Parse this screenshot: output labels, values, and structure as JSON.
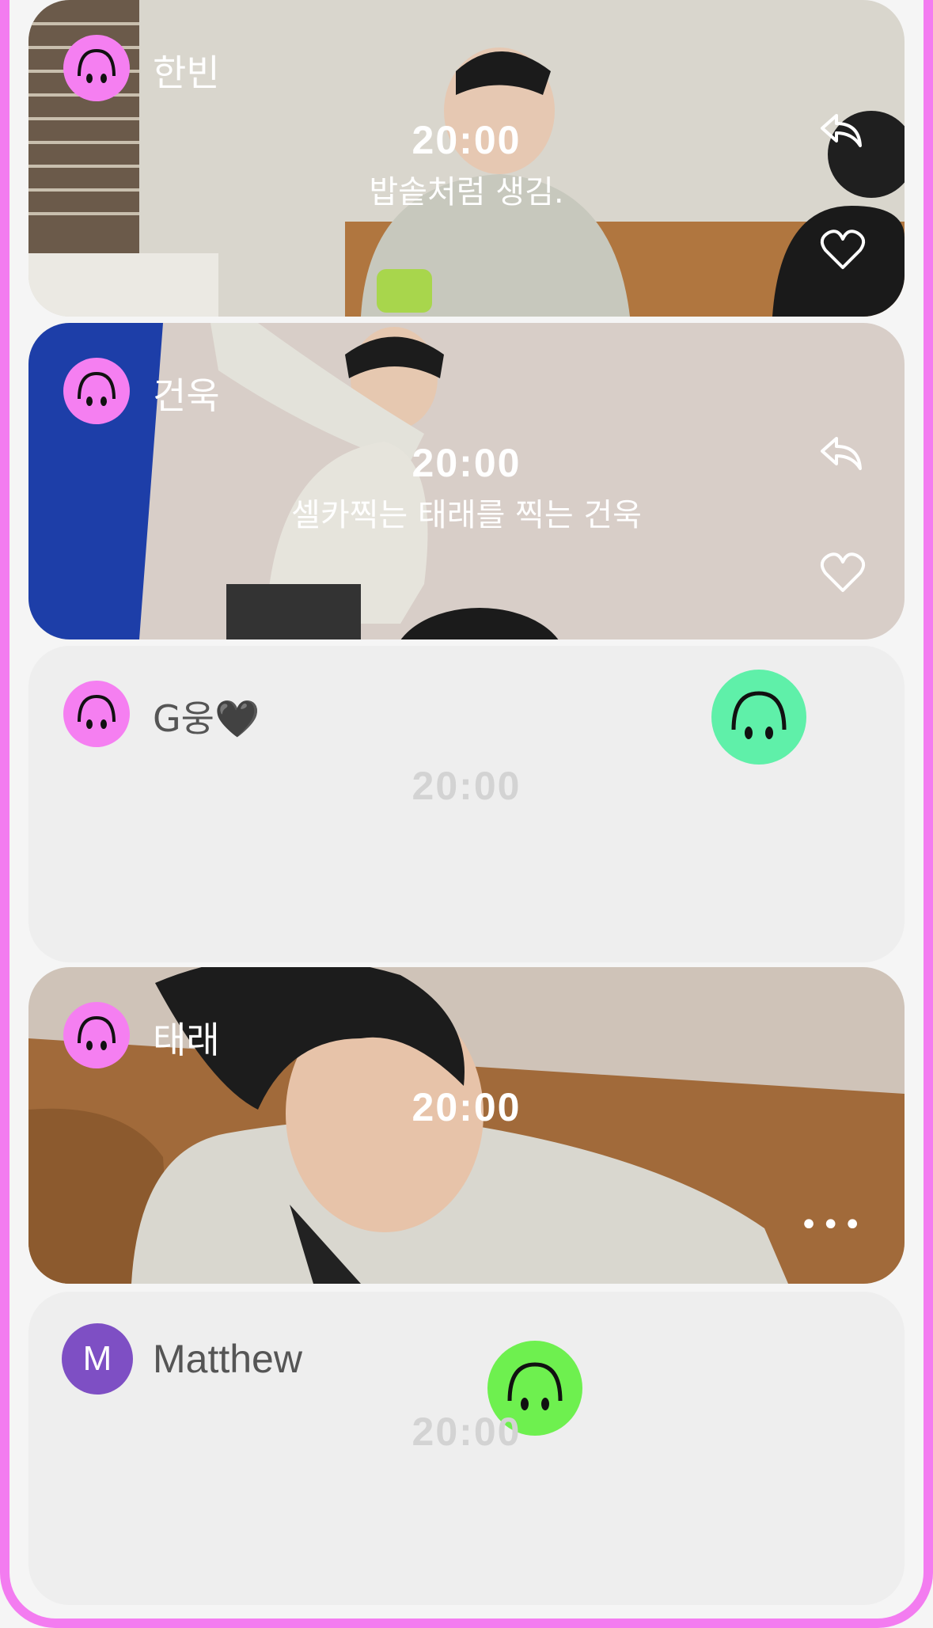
{
  "feed": [
    {
      "username": "한빈",
      "time": "20:00",
      "caption": "밥솥처럼 생김.",
      "avatar_icon": "upside-down-smiley-icon",
      "avatar_color": "#f57ff1",
      "has_actions": true
    },
    {
      "username": "건욱",
      "time": "20:00",
      "caption": "셀카찍는 태래를 찍는 건욱",
      "avatar_icon": "upside-down-smiley-icon",
      "avatar_color": "#f57ff1",
      "has_actions": true
    },
    {
      "username": "G웅🖤",
      "time": "20:00",
      "avatar_icon": "upside-down-smiley-icon",
      "avatar_color": "#f57ff1",
      "reaction_icon": "upside-down-smiley-icon",
      "reaction_color": "#5ff0a9"
    },
    {
      "username": "태래",
      "time": "20:00",
      "avatar_icon": "upside-down-smiley-icon",
      "avatar_color": "#f57ff1",
      "more_label": "•••"
    },
    {
      "username": "Matthew",
      "avatar_letter": "M",
      "avatar_color": "#7e4fc4",
      "time": "20:00",
      "reaction_icon": "upside-down-smiley-icon",
      "reaction_color": "#6ef04f"
    }
  ],
  "colors": {
    "frame": "#f37cf0",
    "background": "#f5f5f5",
    "empty_card": "#eeeeee"
  }
}
